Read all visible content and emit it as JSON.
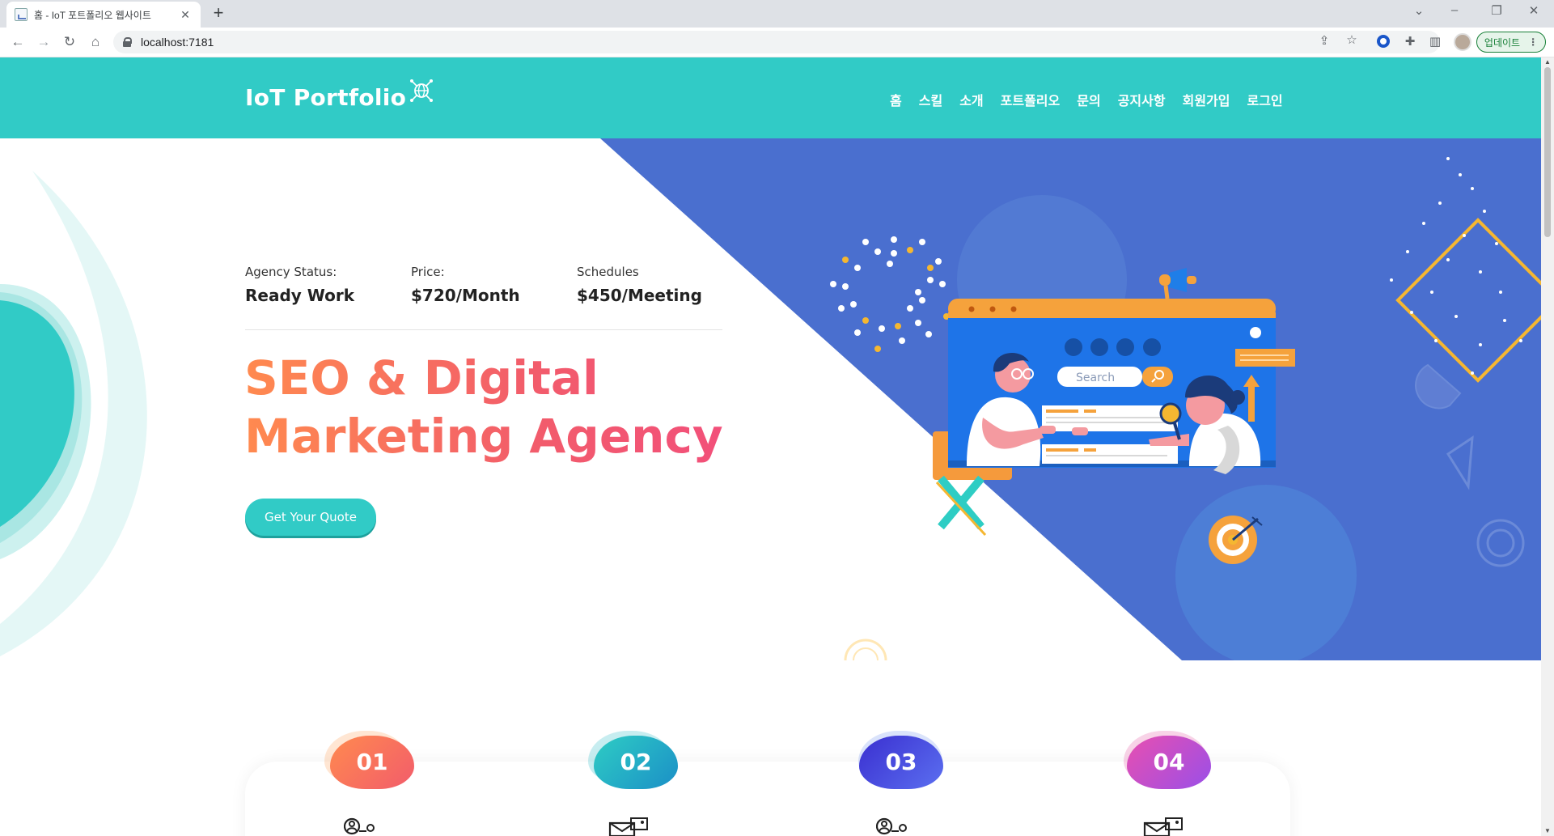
{
  "browser": {
    "tab_title": "홈 - IoT 포트폴리오 웹사이트",
    "url": "localhost:7181",
    "update_label": "업데이트"
  },
  "site": {
    "logo": "IoT Portfolio",
    "nav": [
      "홈",
      "스킬",
      "소개",
      "포트폴리오",
      "문의",
      "공지사항",
      "회원가입",
      "로그인"
    ]
  },
  "hero": {
    "stats": [
      {
        "label": "Agency Status:",
        "value": "Ready Work"
      },
      {
        "label": "Price:",
        "value": "$720/Month"
      },
      {
        "label": "Schedules",
        "value": "$450/Meeting"
      }
    ],
    "headline_line1": "SEO & Digital",
    "headline_line2": "Marketing Agency",
    "cta": "Get Your Quote",
    "search_placeholder": "Search"
  },
  "steps": [
    {
      "number": "01",
      "icon": "user-network-icon"
    },
    {
      "number": "02",
      "icon": "envelope-icon"
    },
    {
      "number": "03",
      "icon": "user-network-icon"
    },
    {
      "number": "04",
      "icon": "envelope-icon"
    }
  ],
  "colors": {
    "header": "#31cbc6",
    "hero_blue": "#4a6fcf",
    "headline_gradient": [
      "#ff8a4f",
      "#f2507a"
    ],
    "step_badges": [
      "#ff7a4f",
      "#1fb6c4",
      "#3a3fd8",
      "#d23fb0"
    ]
  }
}
